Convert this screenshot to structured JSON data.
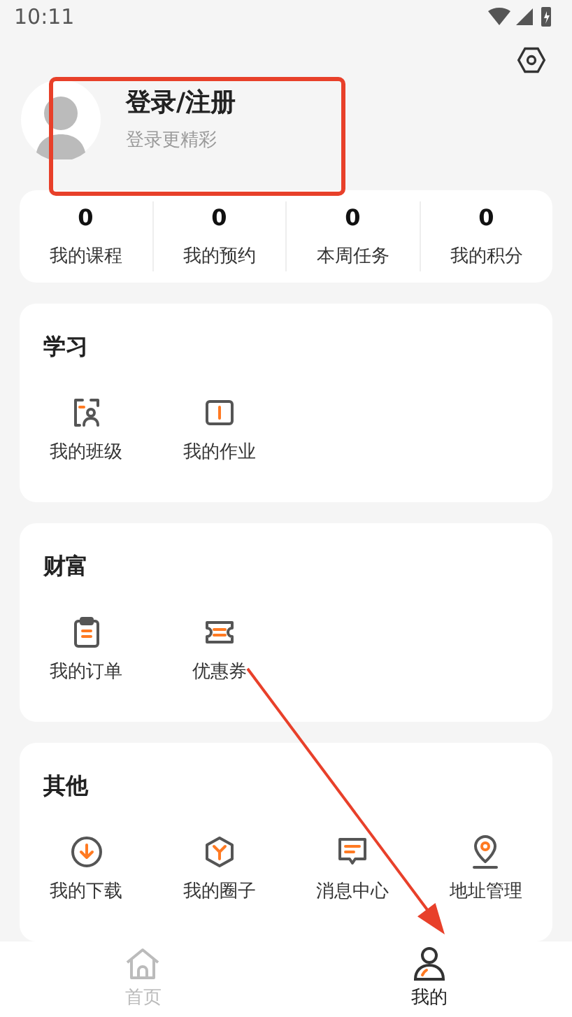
{
  "status_bar": {
    "time": "10:11"
  },
  "profile": {
    "title": "登录/注册",
    "subtitle": "登录更精彩"
  },
  "stats": [
    {
      "value": "0",
      "label": "我的课程"
    },
    {
      "value": "0",
      "label": "我的预约"
    },
    {
      "value": "0",
      "label": "本周任务"
    },
    {
      "value": "0",
      "label": "我的积分"
    }
  ],
  "sections": [
    {
      "title": "学习",
      "items": [
        {
          "label": "我的班级",
          "kind": "class"
        },
        {
          "label": "我的作业",
          "kind": "homework"
        }
      ]
    },
    {
      "title": "财富",
      "items": [
        {
          "label": "我的订单",
          "kind": "order"
        },
        {
          "label": "优惠券",
          "kind": "coupon"
        }
      ]
    },
    {
      "title": "其他",
      "items": [
        {
          "label": "我的下载",
          "kind": "download"
        },
        {
          "label": "我的圈子",
          "kind": "circle"
        },
        {
          "label": "消息中心",
          "kind": "message"
        },
        {
          "label": "地址管理",
          "kind": "address"
        }
      ]
    }
  ],
  "tab_bar": [
    {
      "label": "首页",
      "kind": "home",
      "selected": false
    },
    {
      "label": "我的",
      "kind": "person",
      "selected": true
    }
  ]
}
